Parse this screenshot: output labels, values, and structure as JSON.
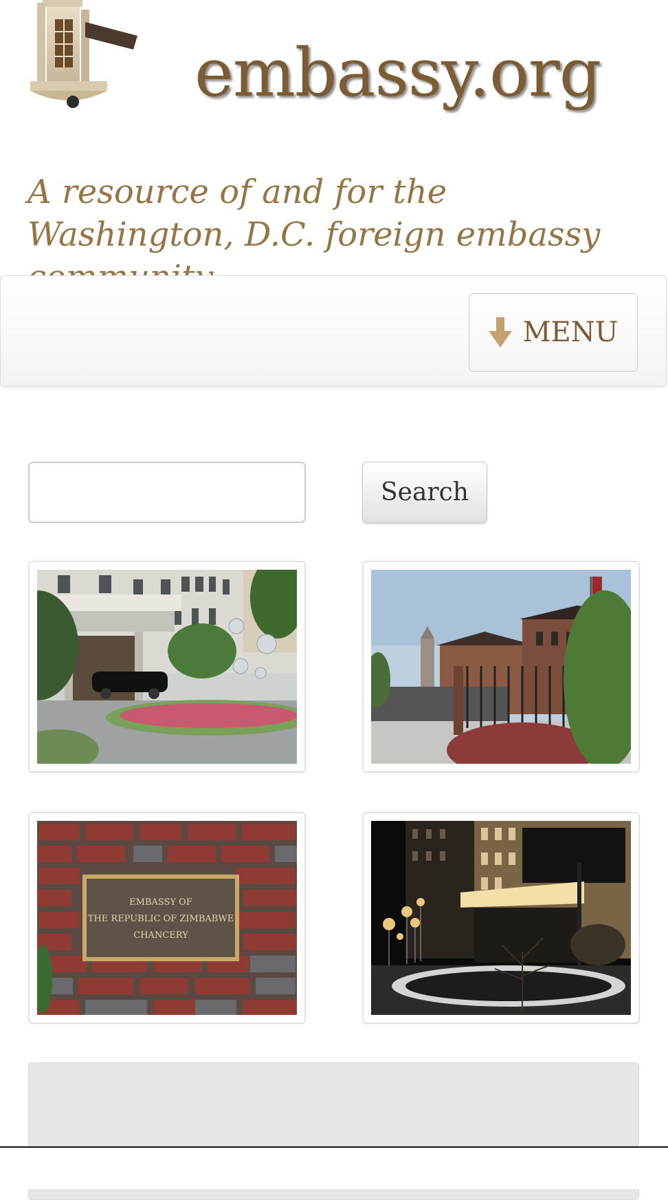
{
  "header": {
    "site_title": "embassy.org",
    "tagline": "A resource of and for the Washington, D.C. foreign embassy community",
    "logo_icon": "embassy-building-icon"
  },
  "nav": {
    "menu_label": "MENU",
    "menu_icon": "arrow-down-icon"
  },
  "search": {
    "value": "",
    "placeholder": "",
    "button_label": "Search"
  },
  "gallery": {
    "images": [
      {
        "name": "embassy-entrance-photo"
      },
      {
        "name": "embassy-gate-photo"
      },
      {
        "name": "zimbabwe-chancery-plaque-photo",
        "plaque_lines": [
          "EMBASSY OF",
          "THE REPUBLIC OF ZIMBABWE",
          "CHANCERY"
        ]
      },
      {
        "name": "embassy-night-photo"
      }
    ]
  },
  "colors": {
    "brand_brown": "#7c5c33",
    "tagline_brown": "#957544",
    "menu_arrow": "#c4a270"
  }
}
